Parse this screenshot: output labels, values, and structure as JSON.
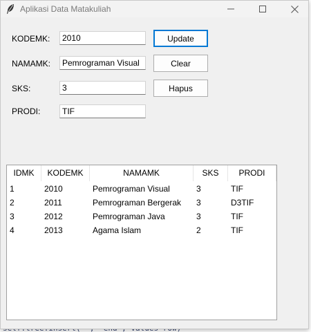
{
  "window": {
    "title": "Aplikasi Data Matakuliah"
  },
  "form": {
    "kodemk_label": "KODEMK:",
    "kodemk_value": "2010",
    "namamk_label": "NAMAMK:",
    "namamk_value": "Pemrograman Visual",
    "sks_label": "SKS:",
    "sks_value": "3",
    "prodi_label": "PRODI:",
    "prodi_value": "TIF"
  },
  "buttons": {
    "update": "Update",
    "clear": "Clear",
    "hapus": "Hapus"
  },
  "table": {
    "columns": [
      "IDMK",
      "KODEMK",
      "NAMAMK",
      "SKS",
      "PRODI"
    ],
    "rows": [
      [
        "1",
        "2010",
        "Pemrograman Visual",
        "3",
        "TIF"
      ],
      [
        "2",
        "2011",
        "Pemrograman Bergerak",
        "3",
        "D3TIF"
      ],
      [
        "3",
        "2012",
        "Pemrograman Java",
        "3",
        "TIF"
      ],
      [
        "4",
        "2013",
        "Agama Islam",
        "2",
        "TIF"
      ]
    ]
  },
  "icons": {
    "app": "feather-icon",
    "minimize": "minimize-icon",
    "maximize": "maximize-icon",
    "close": "close-icon"
  }
}
